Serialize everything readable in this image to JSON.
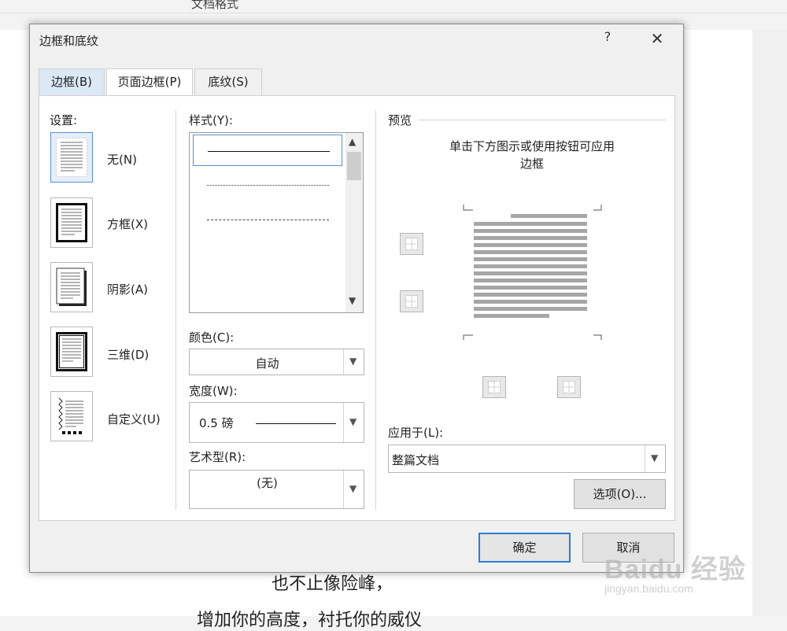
{
  "document": {
    "title_fragment": "文档格式",
    "line1": "也不止像险峰，",
    "line2": "增加你的高度，衬托你的威仪"
  },
  "watermark": {
    "main": "Baidu 经验",
    "sub": "jingyan.baidu.com"
  },
  "dialog": {
    "title": "边框和底纹",
    "help": "?",
    "close": "✕",
    "tabs": [
      "边框(B)",
      "页面边框(P)",
      "底纹(S)"
    ],
    "active_tab": 1,
    "settings": {
      "label": "设置:",
      "items": [
        "无(N)",
        "方框(X)",
        "阴影(A)",
        "三维(D)",
        "自定义(U)"
      ],
      "selected": 0
    },
    "style": {
      "label": "样式(Y):"
    },
    "color": {
      "label": "颜色(C):",
      "value": "自动"
    },
    "width": {
      "label": "宽度(W):",
      "value": "0.5 磅"
    },
    "art": {
      "label": "艺术型(R):",
      "value": "(无)"
    },
    "preview": {
      "label": "预览",
      "hint_line1": "单击下方图示或使用按钮可应用",
      "hint_line2": "边框"
    },
    "apply_to": {
      "label": "应用于(L):",
      "value": "整篇文档"
    },
    "options_button": "选项(O)...",
    "ok_button": "确定",
    "cancel_button": "取消"
  },
  "colors": {
    "accent": "#2c7bd6",
    "selection_bg": "#e5eefa",
    "tab_highlight": "#dbe8f6",
    "preview_lines": "#a6a6a6"
  }
}
